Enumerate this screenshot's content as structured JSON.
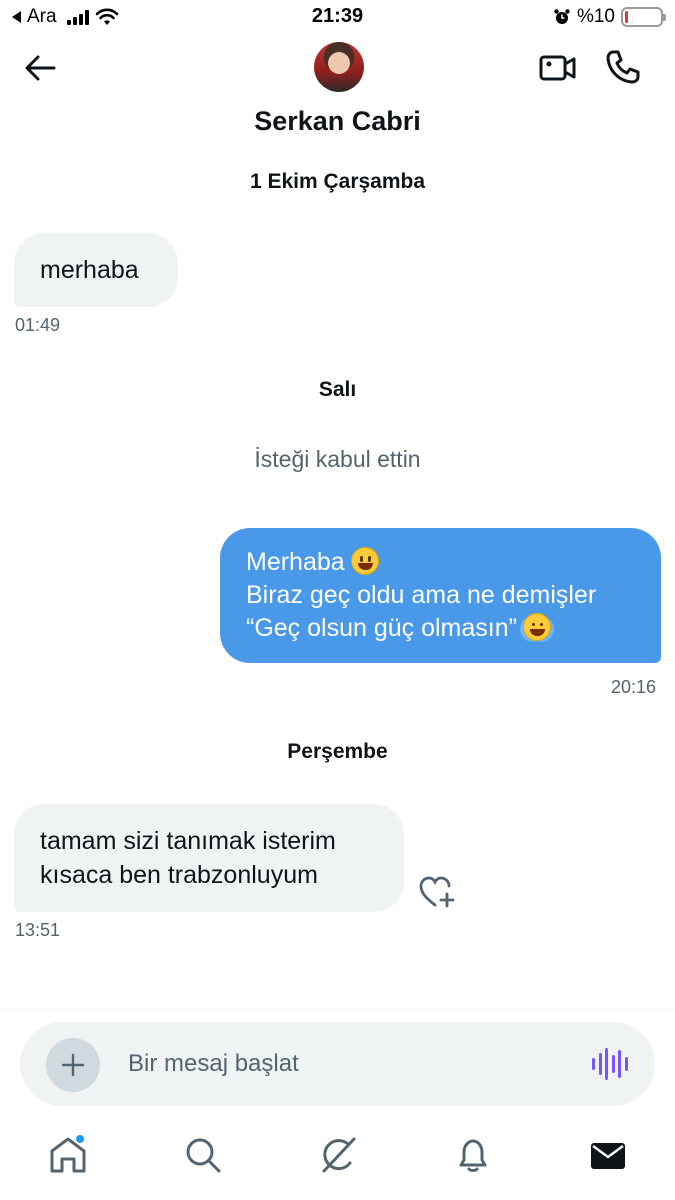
{
  "status_bar": {
    "carrier": "Ara",
    "time": "21:39",
    "battery": "%10",
    "battery_level": 0.1
  },
  "header": {
    "contact_name": "Serkan Cabri"
  },
  "conversation": {
    "sections": [
      {
        "date": "1 Ekim Çarşamba"
      },
      {
        "date": "Salı",
        "system": "İsteği kabul ettin"
      },
      {
        "date": "Perşembe"
      }
    ],
    "messages": [
      {
        "direction": "incoming",
        "lines": [
          "merhaba"
        ],
        "time": "01:49"
      },
      {
        "direction": "outgoing",
        "lines": [
          "Merhaba",
          "Biraz geç oldu ama ne demişler",
          "“Geç olsun güç olmasın”"
        ],
        "time": "20:16",
        "emojis": [
          "grinning-face",
          "face-with-tears-of-joy"
        ]
      },
      {
        "direction": "incoming",
        "lines": [
          "tamam sizi tanımak isterim",
          "kısaca ben trabzonluyum"
        ],
        "time": "13:51"
      }
    ]
  },
  "composer": {
    "placeholder": "Bir mesaj başlat",
    "voice_color": "#7856ff"
  },
  "tabbar": {
    "items": [
      "home-icon",
      "search-icon",
      "grok-icon",
      "notifications-icon",
      "messages-icon"
    ],
    "home_badge_color": "#1d9bf0"
  },
  "colors": {
    "outgoing_bubble": "#4a99e9",
    "incoming_bubble": "#eff3f4",
    "secondary_text": "#536471"
  }
}
